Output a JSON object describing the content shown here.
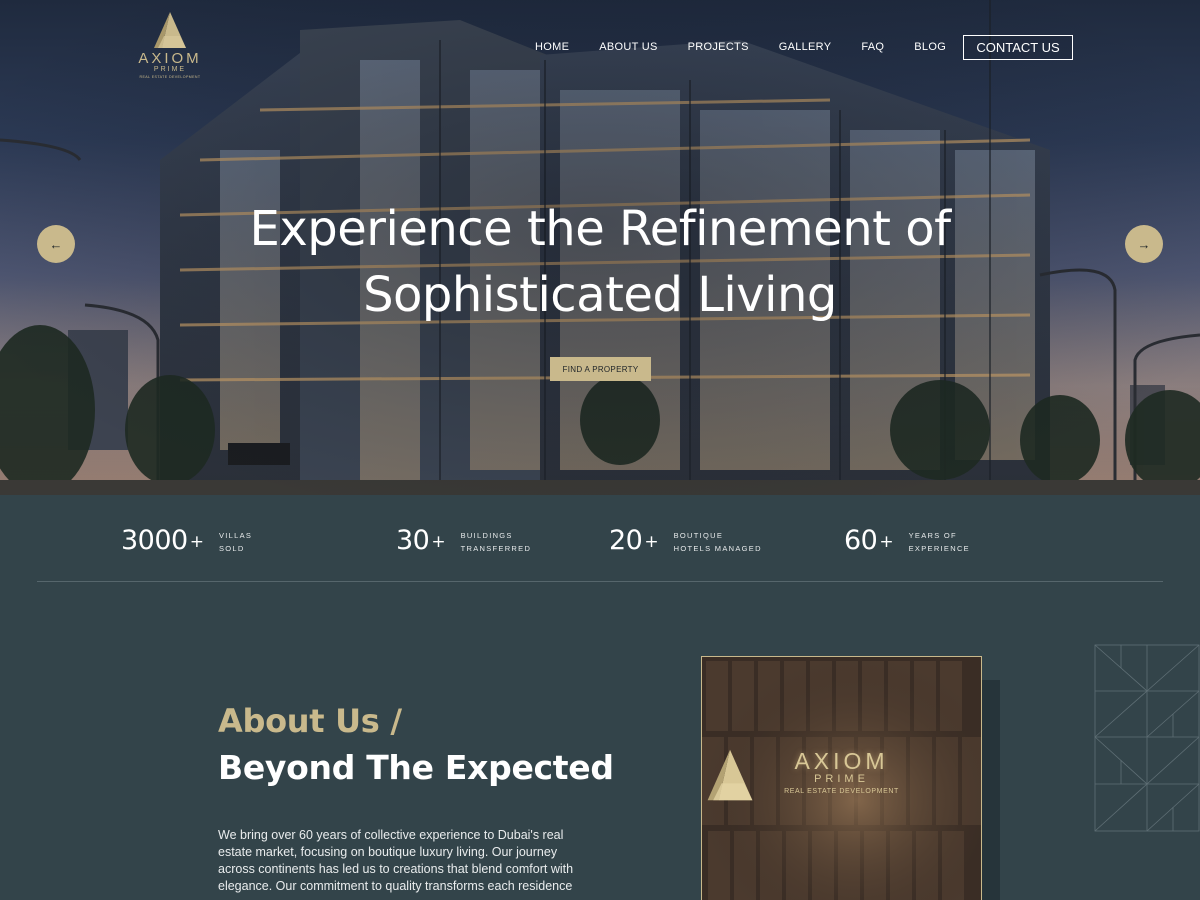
{
  "brand": {
    "name": "AXIOM",
    "sub": "PRIME",
    "tagline": "REAL ESTATE DEVELOPMENT",
    "gold": "#c9b98c"
  },
  "nav": {
    "items": [
      "HOME",
      "ABOUT US",
      "PROJECTS",
      "GALLERY",
      "FAQ",
      "BLOG"
    ],
    "contact_label": "CONTACT US"
  },
  "hero": {
    "title_line1": "Experience the Refinement of",
    "title_line2": "Sophisticated Living",
    "cta_label": "FIND A PROPERTY",
    "prev_icon": "arrow-left-icon",
    "next_icon": "arrow-right-icon",
    "prev_glyph": "←",
    "next_glyph": "→"
  },
  "stats": [
    {
      "number": "3000",
      "plus": "+",
      "label1": "VILLAS",
      "label2": "SOLD"
    },
    {
      "number": "30",
      "plus": "+",
      "label1": "BUILDINGS",
      "label2": "TRANSFERRED"
    },
    {
      "number": "20",
      "plus": "+",
      "label1": "BOUTIQUE",
      "label2": "HOTELS MANAGED"
    },
    {
      "number": "60",
      "plus": "+",
      "label1": "YEARS OF",
      "label2": "EXPERIENCE"
    }
  ],
  "about": {
    "kicker": "About Us /",
    "title": "Beyond The Expected",
    "body": "We bring over 60 years of collective experience to Dubai's real estate market, focusing on boutique luxury living. Our journey across continents has led us to creations that blend comfort with elegance. Our commitment to quality transforms each residence"
  },
  "colors": {
    "background": "#33444a",
    "gold": "#c9b98c",
    "text": "#ffffff"
  }
}
